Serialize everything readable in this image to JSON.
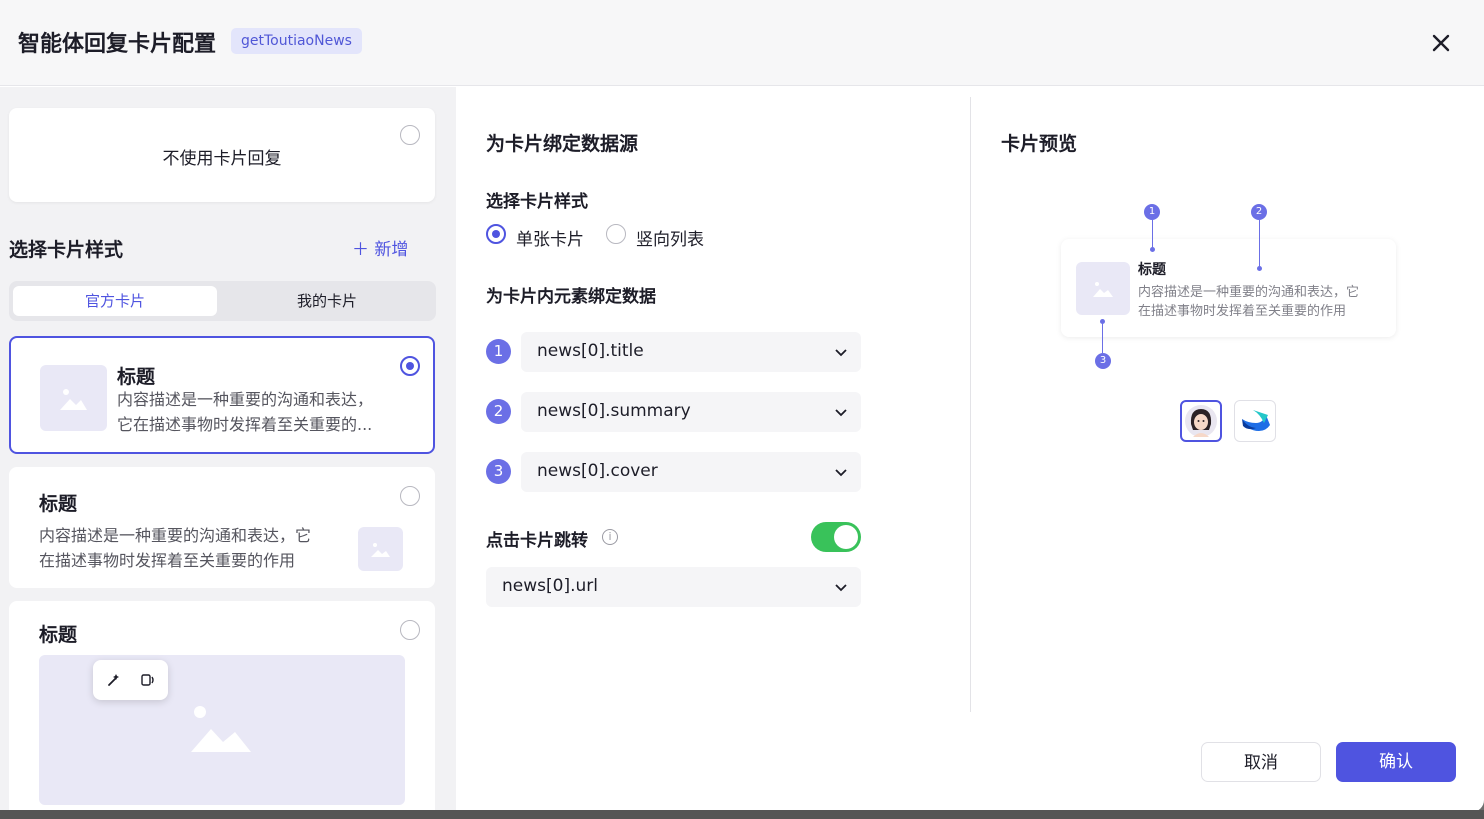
{
  "header": {
    "title": "智能体回复卡片配置",
    "func_tag": "getToutiaoNews"
  },
  "left": {
    "no_card_label": "不使用卡片回复",
    "section_title": "选择卡片样式",
    "add_label": "＋  新增",
    "tabs": [
      {
        "label": "官方卡片",
        "active": true
      },
      {
        "label": "我的卡片",
        "active": false
      }
    ],
    "cards": [
      {
        "title": "标题",
        "desc_line1": "内容描述是一种重要的沟通和表达，",
        "desc_line2": "它在描述事物时发挥着至关重要的...",
        "selected": true
      },
      {
        "title": "标题",
        "desc_line1": "内容描述是一种重要的沟通和表达，它",
        "desc_line2": "在描述事物时发挥着至关重要的作用",
        "selected": false
      },
      {
        "title": "标题",
        "selected": false
      }
    ]
  },
  "middle": {
    "title": "为卡片绑定数据源",
    "style_label": "选择卡片样式",
    "style_options": [
      {
        "label": "单张卡片",
        "selected": true
      },
      {
        "label": "竖向列表",
        "selected": false
      }
    ],
    "bind_label": "为卡片内元素绑定数据",
    "bindings": [
      {
        "num": "1",
        "value": "news[0].title"
      },
      {
        "num": "2",
        "value": "news[0].summary"
      },
      {
        "num": "3",
        "value": "news[0].cover"
      }
    ],
    "jump_label": "点击卡片跳转",
    "jump_enabled": true,
    "jump_value": "news[0].url",
    "info_icon": "i"
  },
  "preview": {
    "title": "卡片预览",
    "card_title": "标题",
    "card_desc_line1": "内容描述是一种重要的沟通和表达，它",
    "card_desc_line2": "在描述事物时发挥着至关重要的作用",
    "pins": [
      "1",
      "2",
      "3"
    ]
  },
  "footer": {
    "cancel_label": "取消",
    "confirm_label": "确认"
  },
  "colors": {
    "accent": "#4f54e0",
    "switch_on": "#39c25a",
    "pin": "#6b6fe6"
  }
}
